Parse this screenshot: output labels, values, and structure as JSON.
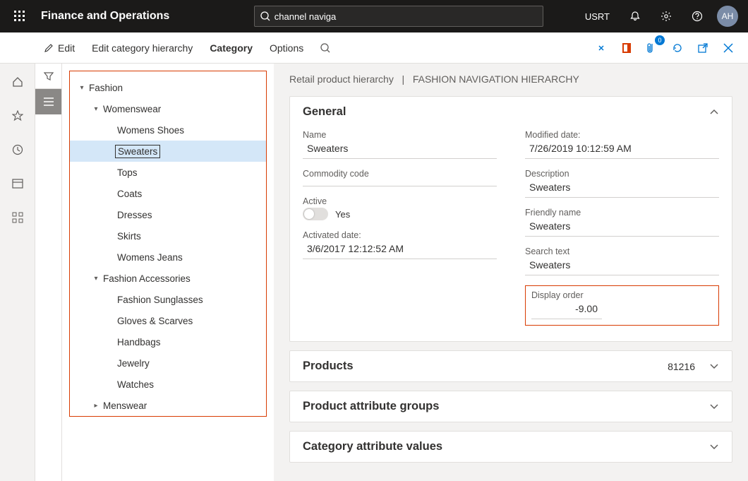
{
  "header": {
    "app_title": "Finance and Operations",
    "search_value": "channel naviga",
    "entity": "USRT",
    "avatar": "AH",
    "badge_count": "0"
  },
  "toolbar": {
    "edit": "Edit",
    "edit_hierarchy": "Edit category hierarchy",
    "category": "Category",
    "options": "Options"
  },
  "tree": {
    "items": [
      {
        "label": "Fashion",
        "indent": 0,
        "arrow": "▾",
        "selected": false
      },
      {
        "label": "Womenswear",
        "indent": 1,
        "arrow": "▾",
        "selected": false
      },
      {
        "label": "Womens Shoes",
        "indent": 2,
        "arrow": "",
        "selected": false
      },
      {
        "label": "Sweaters",
        "indent": 2,
        "arrow": "",
        "selected": true
      },
      {
        "label": "Tops",
        "indent": 2,
        "arrow": "",
        "selected": false
      },
      {
        "label": "Coats",
        "indent": 2,
        "arrow": "",
        "selected": false
      },
      {
        "label": "Dresses",
        "indent": 2,
        "arrow": "",
        "selected": false
      },
      {
        "label": "Skirts",
        "indent": 2,
        "arrow": "",
        "selected": false
      },
      {
        "label": "Womens Jeans",
        "indent": 2,
        "arrow": "",
        "selected": false
      },
      {
        "label": "Fashion Accessories",
        "indent": 1,
        "arrow": "▾",
        "selected": false
      },
      {
        "label": "Fashion Sunglasses",
        "indent": 2,
        "arrow": "",
        "selected": false
      },
      {
        "label": "Gloves & Scarves",
        "indent": 2,
        "arrow": "",
        "selected": false
      },
      {
        "label": "Handbags",
        "indent": 2,
        "arrow": "",
        "selected": false
      },
      {
        "label": "Jewelry",
        "indent": 2,
        "arrow": "",
        "selected": false
      },
      {
        "label": "Watches",
        "indent": 2,
        "arrow": "",
        "selected": false
      },
      {
        "label": "Menswear",
        "indent": 1,
        "arrow": "▸",
        "selected": false
      }
    ]
  },
  "breadcrumb": {
    "parent": "Retail product hierarchy",
    "current": "FASHION NAVIGATION HIERARCHY"
  },
  "general": {
    "title": "General",
    "labels": {
      "name": "Name",
      "commodity": "Commodity code",
      "active": "Active",
      "activated": "Activated date:",
      "modified": "Modified date:",
      "description": "Description",
      "friendly": "Friendly name",
      "search": "Search text",
      "display": "Display order"
    },
    "values": {
      "name": "Sweaters",
      "commodity": "",
      "active": "Yes",
      "activated": "3/6/2017 12:12:52 AM",
      "modified": "7/26/2019 10:12:59 AM",
      "description": "Sweaters",
      "friendly": "Sweaters",
      "search": "Sweaters",
      "display": "-9.00"
    }
  },
  "sections": {
    "products": {
      "title": "Products",
      "count": "81216"
    },
    "attr_groups": {
      "title": "Product attribute groups"
    },
    "cat_attr": {
      "title": "Category attribute values"
    }
  }
}
